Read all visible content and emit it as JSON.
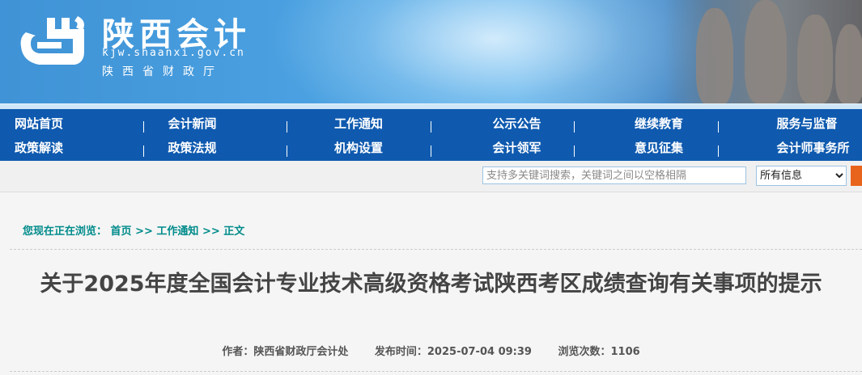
{
  "header": {
    "title": "陕西会计",
    "domain": "kjw.shaanxi.gov.cn",
    "subtitle": "陕西省财政厅",
    "logo_icon": "kuai-ji-logo-icon"
  },
  "nav": {
    "row1": [
      "网站首页",
      "会计新闻",
      "工作通知",
      "公示公告",
      "继续教育",
      "服务与监督"
    ],
    "row2": [
      "政策解读",
      "政策法规",
      "机构设置",
      "会计领军",
      "意见征集",
      "会计师事务所"
    ]
  },
  "search": {
    "placeholder": "支持多关键词搜索，关键词之间以空格相隔",
    "value": "",
    "select_value": "所有信息",
    "button_color": "#e8631c"
  },
  "breadcrumb": {
    "prefix": "您现在正在浏览：",
    "home": "首页",
    "sep1": ">>",
    "section": "工作通知",
    "sep2": ">>",
    "current": "正文"
  },
  "article": {
    "title": "关于2025年度全国会计专业技术高级资格考试陕西考区成绩查询有关事项的提示",
    "author_label": "作者：",
    "author": "陕西省财政厅会计处",
    "date_label": "发布时间：",
    "date": "2025-07-04 09:39",
    "views_label": "浏览次数：",
    "views": "1106"
  },
  "colors": {
    "nav_bg": "#0f5aaf",
    "breadcrumb": "#008b8b",
    "title": "#444444"
  }
}
